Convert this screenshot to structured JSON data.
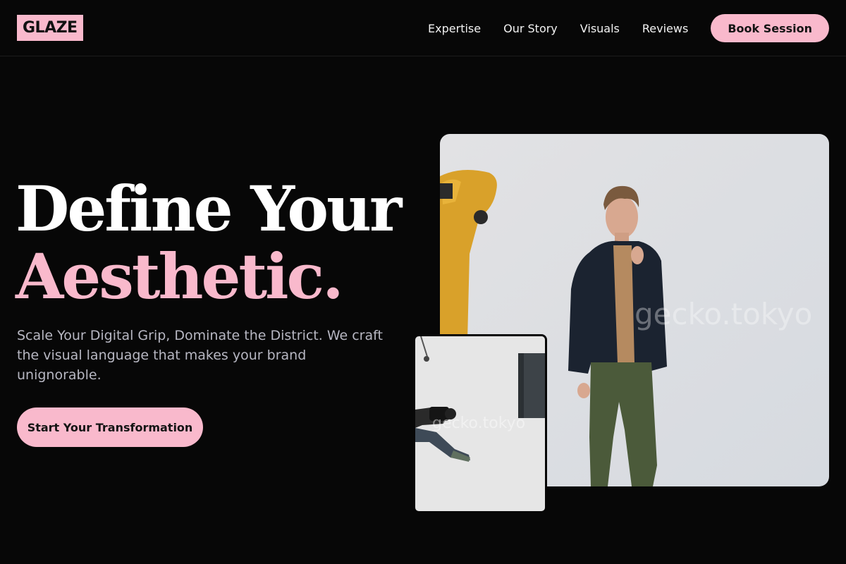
{
  "header": {
    "logo": "GLAZE",
    "nav": [
      {
        "label": "Expertise"
      },
      {
        "label": "Our Story"
      },
      {
        "label": "Visuals"
      },
      {
        "label": "Reviews"
      }
    ],
    "cta_label": "Book Session"
  },
  "hero": {
    "title_line1": "Define Your",
    "title_line2": "Aesthetic.",
    "description": "Scale Your Digital Grip, Dominate the District. We craft the visual language that makes your brand unignorable.",
    "cta_label": "Start Your Transformation"
  },
  "images": {
    "main_watermark": "gecko.tokyo",
    "small_watermark": "gecko.tokyo"
  },
  "colors": {
    "accent": "#f9b9cc",
    "background": "#070707",
    "muted_text": "#b7b7c2"
  }
}
